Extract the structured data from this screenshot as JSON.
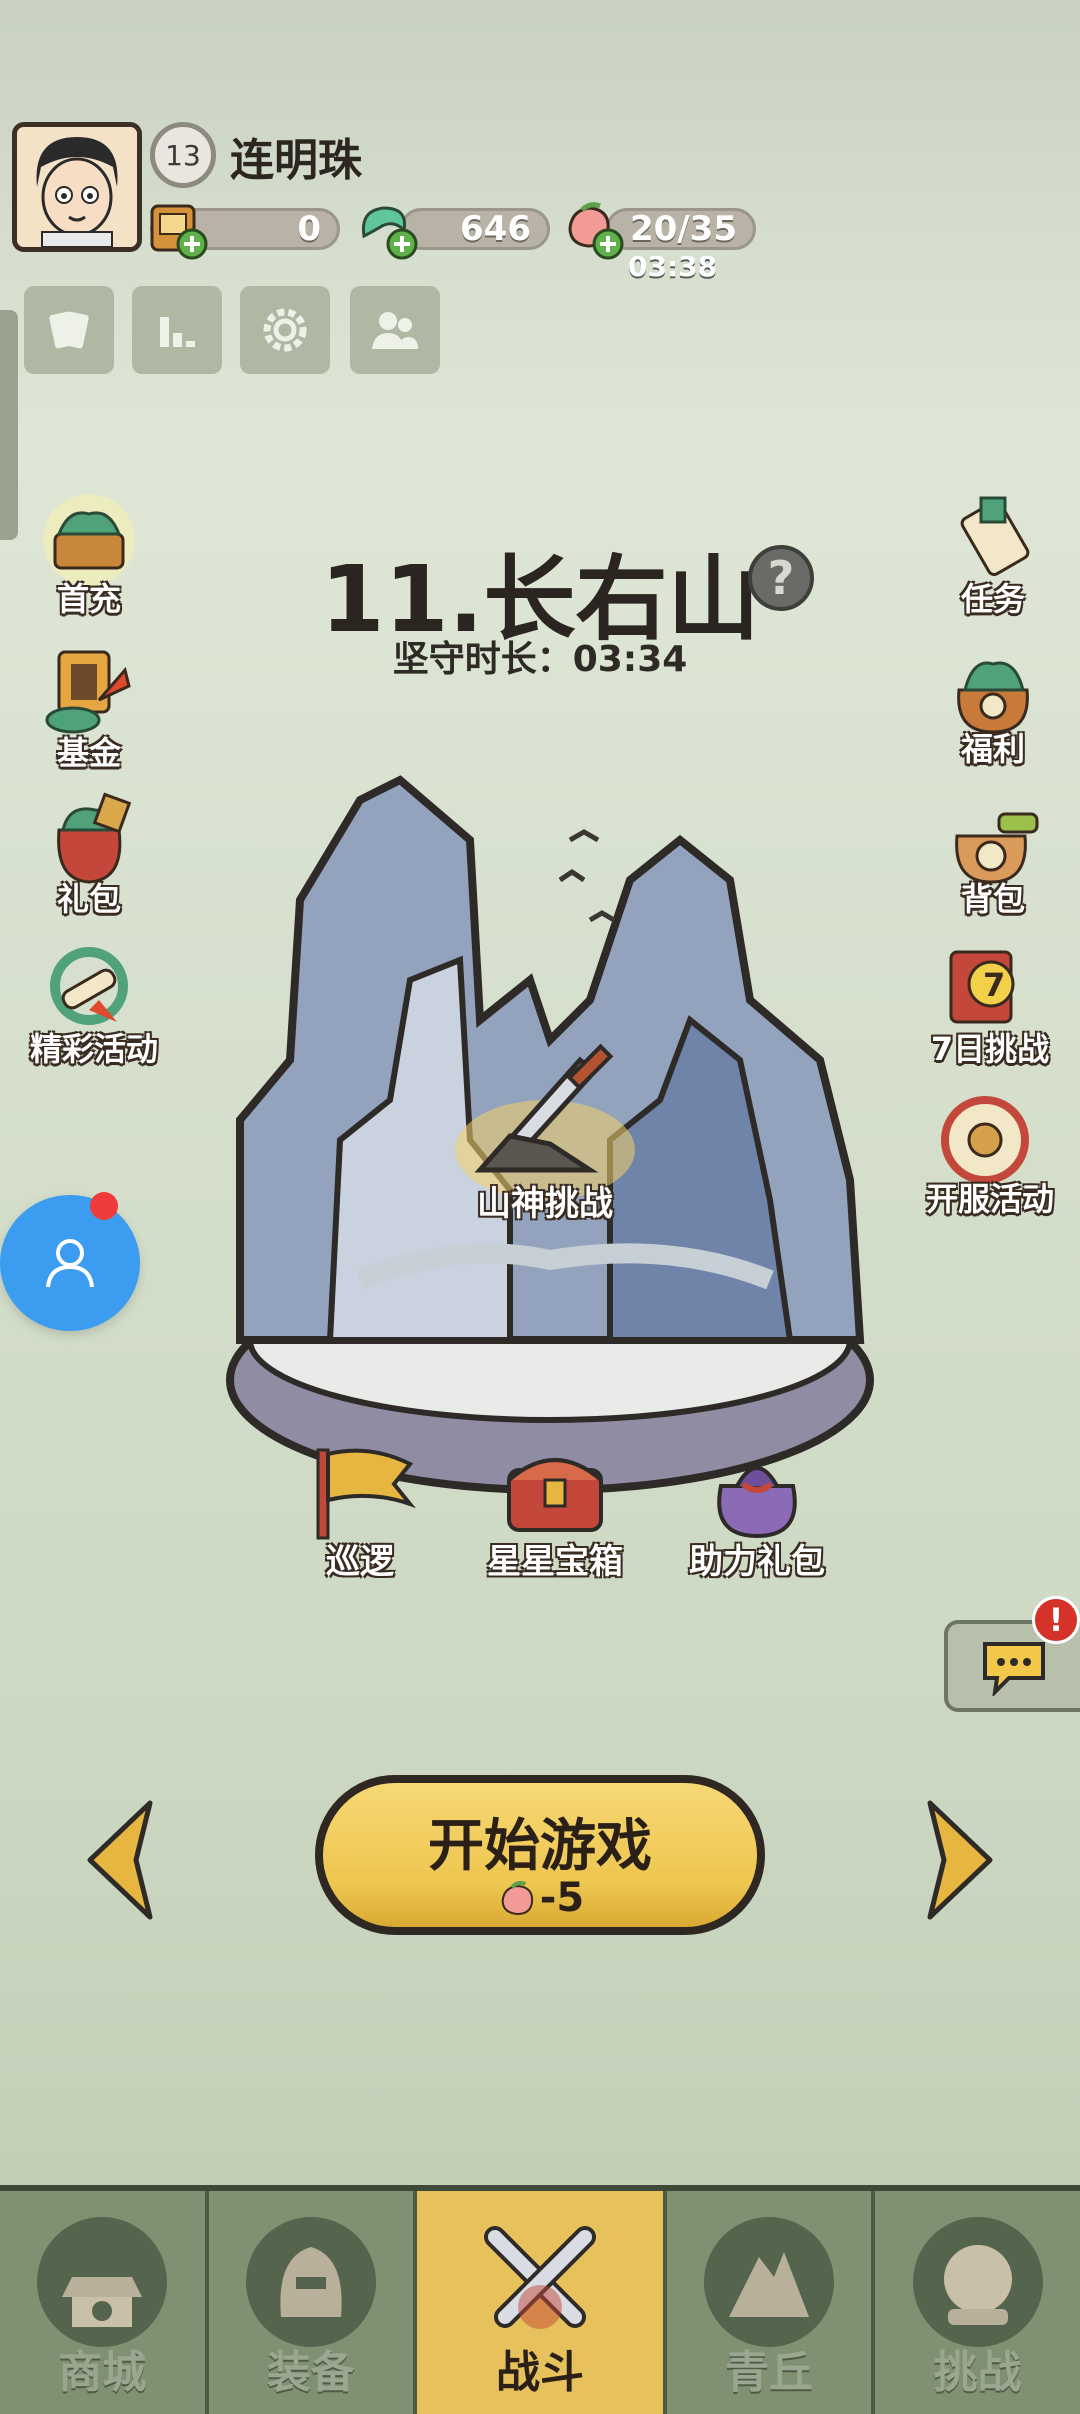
{
  "player": {
    "level": "13",
    "name": "连明珠"
  },
  "resources": {
    "tickets": "0",
    "jade": "646",
    "stamina": "20/35",
    "stamina_timer": "03:38"
  },
  "left_menu": [
    {
      "label": "首充",
      "icon": "first-charge-icon"
    },
    {
      "label": "基金",
      "icon": "fund-icon"
    },
    {
      "label": "礼包",
      "icon": "gift-pack-icon"
    },
    {
      "label": "精彩活动",
      "icon": "events-icon"
    }
  ],
  "right_menu": [
    {
      "label": "任务",
      "icon": "task-icon"
    },
    {
      "label": "福利",
      "icon": "welfare-icon"
    },
    {
      "label": "背包",
      "icon": "backpack-icon"
    },
    {
      "label": "7日挑战",
      "icon": "seven-day-icon"
    },
    {
      "label": "开服活动",
      "icon": "server-event-icon"
    }
  ],
  "stage": {
    "title": "11.长右山",
    "guard_time": "坚守时长：03:34",
    "boss_label": "山神挑战"
  },
  "stage_actions": [
    {
      "label": "巡逻"
    },
    {
      "label": "星星宝箱"
    },
    {
      "label": "助力礼包"
    }
  ],
  "start": {
    "label": "开始游戏",
    "cost": "-5"
  },
  "chat": {
    "alert": "!"
  },
  "nav": [
    {
      "label": "商城"
    },
    {
      "label": "装备"
    },
    {
      "label": "战斗"
    },
    {
      "label": "青丘"
    },
    {
      "label": "挑战"
    }
  ],
  "colors": {
    "accent": "#e7c15b",
    "nav_bg": "#6d7f62",
    "float_button": "#3b9cf0"
  }
}
